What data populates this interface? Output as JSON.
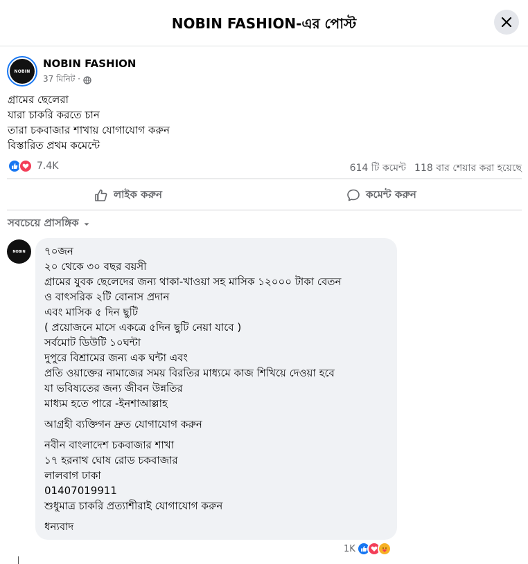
{
  "header": {
    "title": "NOBIN FASHION-এর পোস্ট"
  },
  "post": {
    "page_name": "NOBIN FASHION",
    "avatar_text": "NOBIN",
    "time": "37 মিনিট ·",
    "lines": [
      "গ্রামের ছেলেরা",
      "যারা চাকরি করতে চান",
      "তারা চকবাজার শাখায় যোগাযোগ করুন",
      "বিস্তারিত প্রথম কমেন্টে"
    ],
    "reaction_count": "7.4K",
    "comment_count": "614 টি কমেন্ট",
    "share_count": "118 বার শেয়ার করা হয়েছে"
  },
  "actions": {
    "like": "লাইক করুন",
    "comment": "কমেন্ট করুন"
  },
  "sort": {
    "label": "সবচেয়ে প্রাসঙ্গিক"
  },
  "comment": {
    "avatar_text": "NOBIN",
    "lines": [
      "৭০জন",
      "২০ থেকে ৩০ বছর বয়সী",
      "গ্রামের যুবক ছেলেদের জন্য থাকা-খাওয়া সহ মাসিক ১২০০০ টাকা বেতন",
      "ও বাৎসরিক ২টি বোনাস প্রদান",
      "এবং মাসিক ৫ দিন ছুটি",
      "( প্রয়োজনে মাসে একত্রে ৫দিন ছুটি নেয়া যাবে )",
      "সর্বমোট ডিউটি ১০ঘন্টা",
      "দুপুরে বিশ্রামের জন্য এক ঘন্টা এবং",
      "প্রতি ওয়াক্তের নামাজের সময় বিরতির মাধ্যমে কাজ শিখিয়ে দেওয়া হবে",
      "যা ভবিষ্যতের জন্য জীবন উন্নতির",
      "মাধ্যম হতে পারে -ইনশাআল্লাহ",
      "আগ্রহী ব্যক্তিগন দ্রুত যোগাযোগ করুন",
      "নবীন বাংলাদেশ চকবাজার শাখা",
      "১৭ হরনাথ ঘোষ রোড চকবাজার",
      "লালবাগ ঢাকা",
      "01407019911",
      "শুধুমাত্র চাকরি প্রত্যাশীরাই যোগাযোগ করুন",
      "ধন্যবাদ"
    ],
    "reaction_count": "1K"
  }
}
